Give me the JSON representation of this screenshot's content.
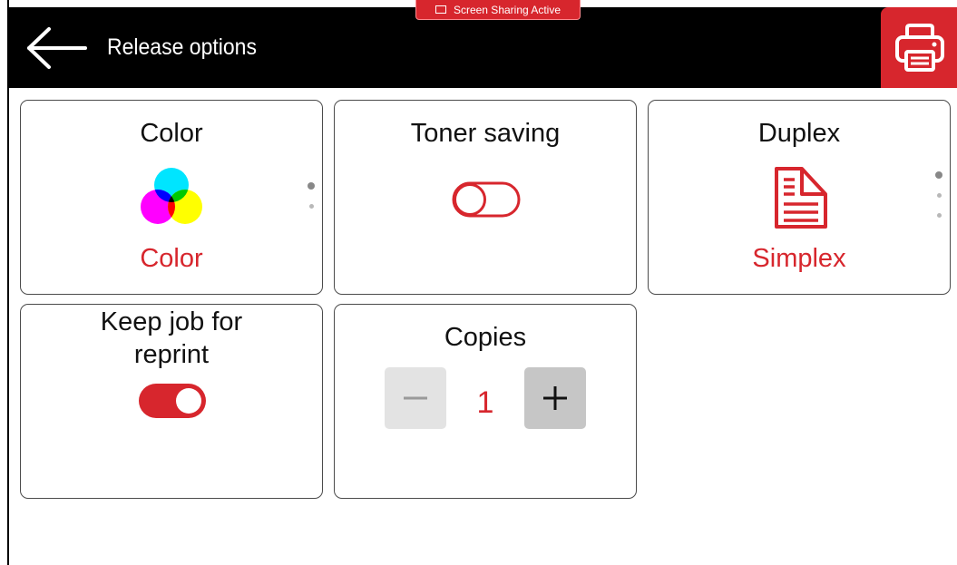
{
  "header": {
    "title": "Release options",
    "back_icon": "arrow-left-icon",
    "print_icon": "printer-icon",
    "print_button_color": "#d7262d"
  },
  "screen_sharing": {
    "label": "Screen Sharing Active",
    "icon": "monitor-icon"
  },
  "tiles": {
    "color": {
      "title": "Color",
      "value": "Color",
      "icon": "rgb-color-wheel-icon",
      "page_indicator": {
        "count": 2,
        "active": 1
      }
    },
    "toner_saving": {
      "title": "Toner saving",
      "state": "off"
    },
    "duplex": {
      "title": "Duplex",
      "value": "Simplex",
      "icon": "simplex-document-icon",
      "page_indicator": {
        "count": 3,
        "active": 1
      }
    },
    "keep_job": {
      "title_line1": "Keep job for",
      "title_line2": "reprint",
      "state": "on"
    },
    "copies": {
      "title": "Copies",
      "value": "1",
      "decrement_label": "−",
      "increment_label": "+",
      "decrement_enabled": false
    }
  },
  "colors": {
    "accent": "#d7262d",
    "header_bg": "#000000",
    "tile_border": "#4b4b4b"
  }
}
